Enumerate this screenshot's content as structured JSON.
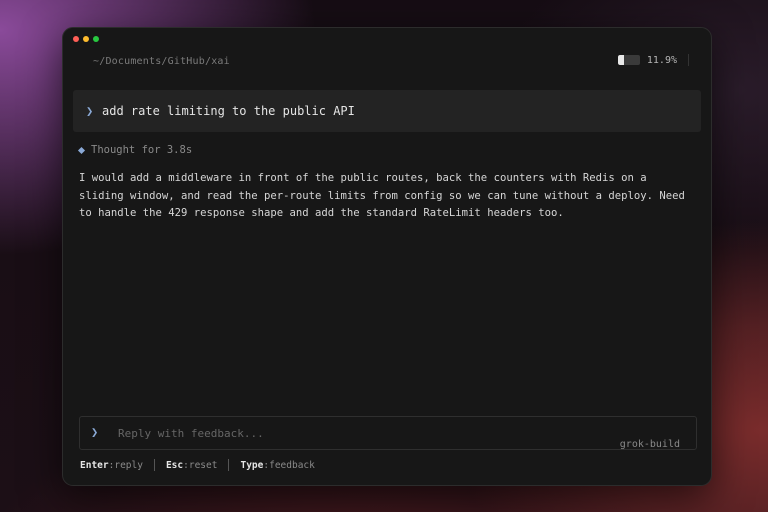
{
  "window": {
    "path": "~/Documents/GitHub/xai",
    "usage_percent": "11.9%",
    "usage_fraction": 0.3
  },
  "prompt": {
    "chevron": "❯",
    "text": "add rate limiting to the public API"
  },
  "thought": {
    "label": "Thought for 3.8s"
  },
  "response": {
    "text": "I would add a middleware in front of the public routes, back the counters with Redis on a\nsliding window, and read the per-route limits from config so we can tune without a deploy. Need\nto handle the 429 response shape and add the standard RateLimit headers too."
  },
  "reply": {
    "chevron": "❯",
    "placeholder": "Reply with feedback...",
    "value": "",
    "model": "grok-build"
  },
  "hints": [
    {
      "key": "Enter",
      "sep": ":",
      "action": "reply"
    },
    {
      "key": "Esc",
      "sep": ":",
      "action": "reset"
    },
    {
      "key": "Type",
      "sep": ":",
      "action": "feedback"
    }
  ],
  "colors": {
    "accent": "#8aa9d6",
    "window_bg": "#171717",
    "prompt_bg": "#232323"
  }
}
